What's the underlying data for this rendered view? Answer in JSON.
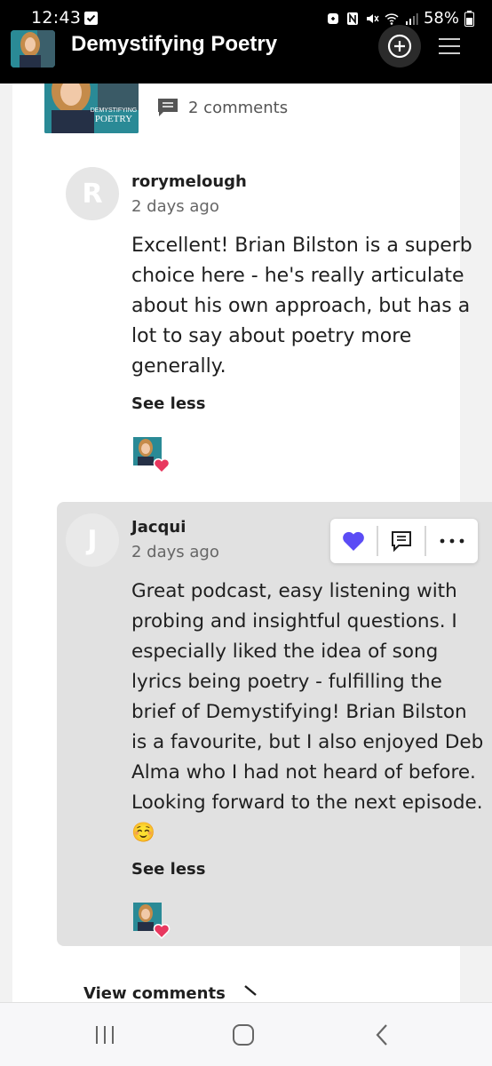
{
  "status_bar": {
    "time": "12:43",
    "battery": "58%",
    "icons": [
      "checkbox-icon",
      "battery-saver-icon",
      "nfc-icon",
      "mute-icon",
      "wifi-icon",
      "signal-icon",
      "battery-icon"
    ]
  },
  "header": {
    "title": "Demystifying Poetry",
    "logo_icon": "demystifying-poetry-logo",
    "add_icon": "plus-circle-icon",
    "menu_icon": "hamburger-menu-icon"
  },
  "post": {
    "thumbnail_text": "DEMYSTIFYING POETRY",
    "comments_label": "2 comments"
  },
  "comments": [
    {
      "avatar_letter": "R",
      "author": "rorymelough",
      "time": "2 days ago",
      "body": "Excellent! Brian Bilston is a superb choice here - he's really articulate about his own approach, but has a lot to say about poetry more generally.",
      "toggle": "See less"
    },
    {
      "avatar_letter": "J",
      "author": "Jacqui",
      "time": "2 days ago",
      "body": "Great podcast, easy listening with probing and insightful questions. I especially liked the idea of song lyrics being poetry - fulfilling the brief of Demystifying! Brian Bilston is a favourite, but I also enjoyed Deb Alma who I had not heard of before. Looking forward to the next episode. ☺️",
      "toggle": "See less"
    }
  ],
  "action_bar": {
    "like_icon": "heart-icon",
    "reply_icon": "reply-comment-icon",
    "more_icon": "more-dots-icon"
  },
  "footer": {
    "view_comments": "View comments"
  },
  "colors": {
    "accent": "#5b4cf5",
    "heart": "#e8385f",
    "highlight_bg": "#e1e1e1"
  },
  "nav": [
    "recents-icon",
    "home-icon",
    "back-icon"
  ]
}
